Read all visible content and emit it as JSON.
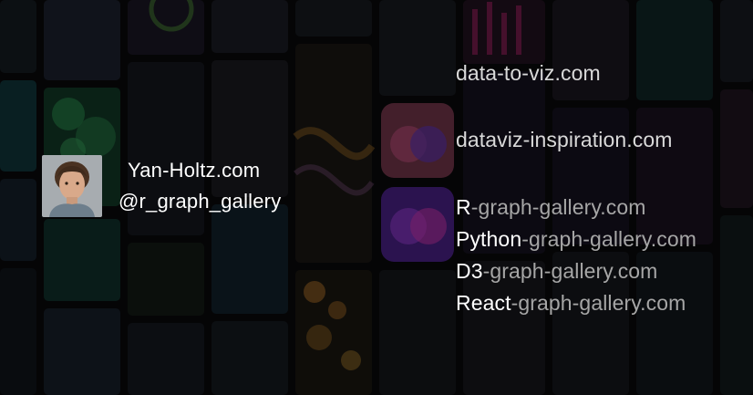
{
  "author": {
    "site": "Yan-Holtz.com",
    "handle": "@r_graph_gallery"
  },
  "links": [
    {
      "text": "data-to-viz.com"
    },
    {
      "text": "dataviz-inspiration.com"
    }
  ],
  "galleries": [
    {
      "lead": "R",
      "rest": "-graph-gallery.com"
    },
    {
      "lead": "Python",
      "rest": "-graph-gallery.com"
    },
    {
      "lead": "D3",
      "rest": "-graph-gallery.com"
    },
    {
      "lead": "React",
      "rest": "-graph-gallery.com"
    }
  ]
}
